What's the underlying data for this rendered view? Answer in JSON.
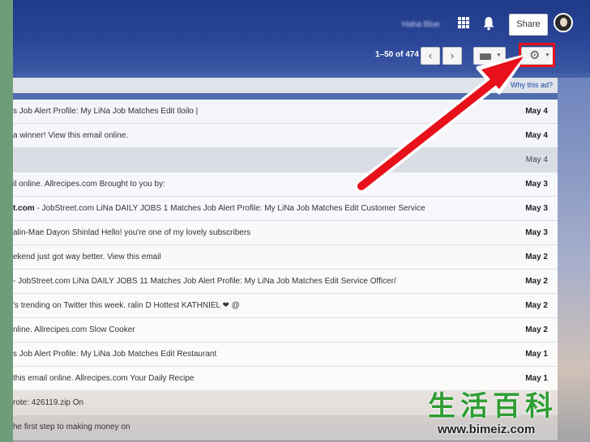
{
  "header": {
    "account_name": "Haha Blue",
    "share_label": "Share"
  },
  "toolbar": {
    "page_count": "1–50 of 474",
    "prev_label": "‹",
    "next_label": "›"
  },
  "ad": {
    "why_link": "Why this ad?"
  },
  "emails": [
    {
      "snippet": "s Job Alert Profile: My LiNa Job Matches Edit Iloilo |",
      "date": "May 4",
      "state": "unread"
    },
    {
      "snippet": "a winner! View this email online.",
      "date": "May 4",
      "state": "unread"
    },
    {
      "snippet": "",
      "date": "May 4",
      "state": "read"
    },
    {
      "snippet": "il online. Allrecipes.com Brought to you by:",
      "date": "May 3",
      "state": "unread"
    },
    {
      "sender": "t.com",
      "snippet": " - JobStreet.com LiNa DAILY JOBS 1 Matches Job Alert Profile: My LiNa Job Matches Edit Customer Service",
      "date": "May 3",
      "state": "unread"
    },
    {
      "snippet": "alin-Mae Dayon Shinlad Hello! you're one of my lovely subscribers",
      "date": "May 3",
      "state": "unread"
    },
    {
      "snippet": "ekend just got way better. View this email",
      "date": "May 2",
      "state": "unread"
    },
    {
      "snippet": "- JobStreet.com LiNa DAILY JOBS 11 Matches Job Alert Profile: My LiNa Job Matches Edit Service Officer/",
      "date": "May 2",
      "state": "unread"
    },
    {
      "snippet": "'s trending on Twitter this week. ralin D Hottest KATHNIEL ❤ @",
      "date": "May 2",
      "state": "unread"
    },
    {
      "snippet": "nline. Allrecipes.com Slow Cooker",
      "date": "May 2",
      "state": "unread"
    },
    {
      "snippet": "s Job Alert Profile: My LiNa Job Matches Edit Restaurant",
      "date": "May 1",
      "state": "unread"
    },
    {
      "snippet": "this email online. Allrecipes.com Your Daily Recipe",
      "date": "May 1",
      "state": "unread"
    },
    {
      "snippet": "rote:  426119.zip  On",
      "date": "",
      "state": "faded"
    },
    {
      "snippet": "he first step to making money on",
      "date": "",
      "state": "faded2"
    }
  ],
  "watermark": {
    "chars": "生活百科",
    "url": "www.bimeiz.com"
  },
  "colors": {
    "highlight": "#e8101a",
    "header": "#2b4597",
    "watermark_green": "#2f9d34"
  }
}
